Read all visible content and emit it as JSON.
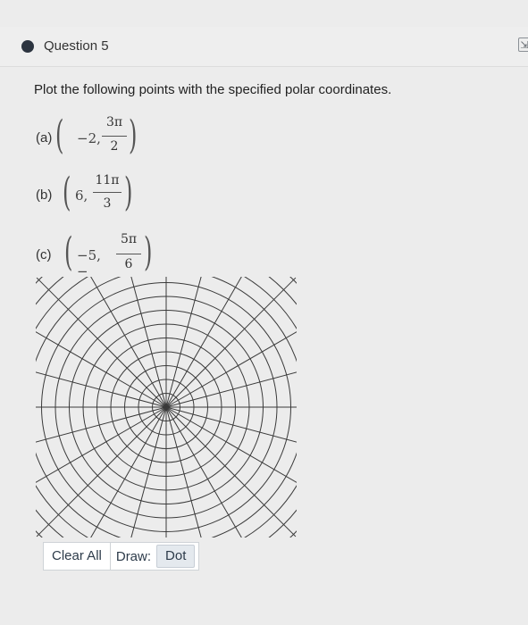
{
  "header": {
    "title": "Question 5",
    "indicator_color": "#2c3440"
  },
  "prompt": "Plot the following points with the specified polar coordinates.",
  "items": [
    {
      "label": "(a)",
      "r": "−2,",
      "num": "3π",
      "den": "2"
    },
    {
      "label": "(b)",
      "r": "6,",
      "num": "11π",
      "den": "3"
    },
    {
      "label": "(c)",
      "r": "−5, −",
      "num": "5π",
      "den": "6"
    }
  ],
  "toolbar": {
    "clear_label": "Clear All",
    "draw_label": "Draw:",
    "dot_label": "Dot"
  },
  "icons": {
    "corner": "expand-icon"
  },
  "polar_grid": {
    "rings": 10,
    "spokes_degrees": 15
  }
}
